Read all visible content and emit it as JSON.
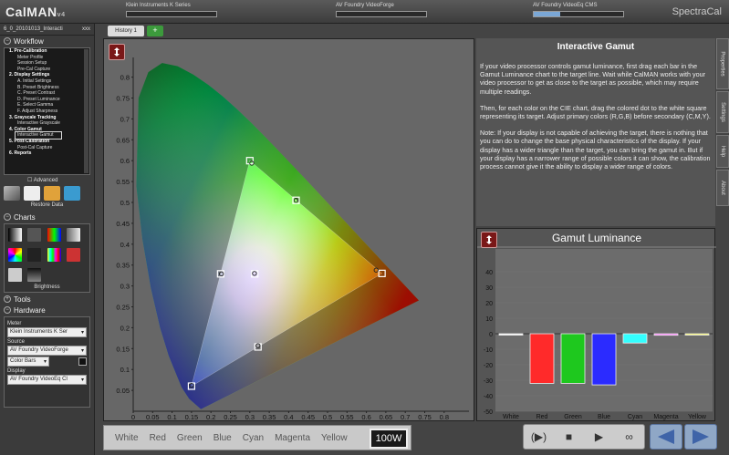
{
  "app": {
    "logo": "CalMAN",
    "logo_version": "v4",
    "brand": "SpectraCal"
  },
  "devices": {
    "meter_label": "Klein Instruments K Series",
    "source_label": "AV Foundry VideoForge",
    "display_label": "AV Foundry VideoEq CMS",
    "display_progress": 0.3
  },
  "session": {
    "name": "6_0_20101013_Interacti",
    "suffix": "xxx"
  },
  "sidebar": {
    "workflow_title": "Workflow",
    "workflow_items": [
      {
        "label": "1. Pre-Calibration",
        "head": true
      },
      {
        "label": "Meter Profile",
        "head": false
      },
      {
        "label": "Session Setup",
        "head": false
      },
      {
        "label": "Pre-Cal Capture",
        "head": false
      },
      {
        "label": "2. Display Settings",
        "head": true
      },
      {
        "label": "A. Initial Settings",
        "head": false
      },
      {
        "label": "B. Preset Brightness",
        "head": false
      },
      {
        "label": "C. Preset Contrast",
        "head": false
      },
      {
        "label": "D. Preset Luminance",
        "head": false
      },
      {
        "label": "E. Select Gamma",
        "head": false
      },
      {
        "label": "F. Adjust Sharpness",
        "head": false
      },
      {
        "label": "3. Grayscale Tracking",
        "head": true
      },
      {
        "label": "Interactive Grayscale",
        "head": false
      },
      {
        "label": "4. Color Gamut",
        "head": true
      },
      {
        "label": "Interactive Gamut",
        "head": false,
        "selected": true
      },
      {
        "label": "5. Post-Calibration",
        "head": true
      },
      {
        "label": "Post-Cal Capture",
        "head": false
      },
      {
        "label": "6. Reports",
        "head": true
      }
    ],
    "advanced_label": "Advanced",
    "restore_label": "Restore Data",
    "charts_title": "Charts",
    "brightness_label": "Brightness",
    "tools_title": "Tools",
    "hardware_title": "Hardware",
    "meter_label": "Meter",
    "meter_value": "Klein Instruments K Ser",
    "source_label": "Source",
    "source_value": "AV Foundry VideoForge",
    "pattern_value": "Color Bars",
    "display_label": "Display",
    "display_value": "AV Foundry VideoEq Cl"
  },
  "history": {
    "tab_label": "History 1",
    "add_label": "+"
  },
  "cie": {
    "x_ticks": [
      "0",
      "0.05",
      "0.1",
      "0.15",
      "0.2",
      "0.25",
      "0.3",
      "0.35",
      "0.4",
      "0.45",
      "0.5",
      "0.55",
      "0.6",
      "0.65",
      "0.7",
      "0.75",
      "0.8"
    ],
    "y_ticks": [
      "0.8",
      "0.75",
      "0.7",
      "0.65",
      "0.6",
      "0.55",
      "0.5",
      "0.45",
      "0.4",
      "0.35",
      "0.3",
      "0.25",
      "0.2",
      "0.15",
      "0.1",
      "0.05",
      "0"
    ]
  },
  "color_bar": {
    "items": [
      "White",
      "Red",
      "Green",
      "Blue",
      "Cyan",
      "Magenta",
      "Yellow"
    ],
    "level": "100W"
  },
  "info": {
    "title": "Interactive Gamut",
    "paragraphs": [
      "If your video processor controls gamut luminance, first drag each bar in the Gamut Luminance chart to the target line. Wait while CalMAN works with your video processor to get as close to the target as possible, which may require multiple readings.",
      "Then, for each color on the CIE chart, drag the colored dot to the white square representing its target.  Adjust primary colors (R,G,B) before secondary (C,M,Y).",
      "Note:  If your display is not capable of achieving the target, there is nothing that you can do to change the base physical characteristics of the display.  If your display has a wider triangle than the target, you can bring the gamut in.  But if your display has a narrower range of possible colors it can show, the calibration process cannot give it the ability to display a wider range of colors."
    ]
  },
  "vtabs": [
    "Properties",
    "Settings",
    "Help",
    "About"
  ],
  "chart_data": {
    "type": "bar",
    "title": "Gamut Luminance",
    "categories": [
      "White",
      "Red",
      "Green",
      "Blue",
      "Cyan",
      "Magenta",
      "Yellow"
    ],
    "values": [
      0,
      -32,
      -32,
      -33,
      -6,
      -1,
      -0.5
    ],
    "colors": [
      "#ffffff",
      "#ff2a2a",
      "#1ec81e",
      "#2b2bff",
      "#33ffff",
      "#ff66ff",
      "#ffff44"
    ],
    "ylim": [
      -50,
      50
    ],
    "y_ticks": [
      40,
      30,
      20,
      10,
      0,
      -10,
      -20,
      -30,
      -40,
      -50
    ],
    "xlabel": "",
    "ylabel": ""
  },
  "playback": {
    "buttons": [
      "(▶)",
      "■",
      "▶",
      "∞"
    ]
  }
}
